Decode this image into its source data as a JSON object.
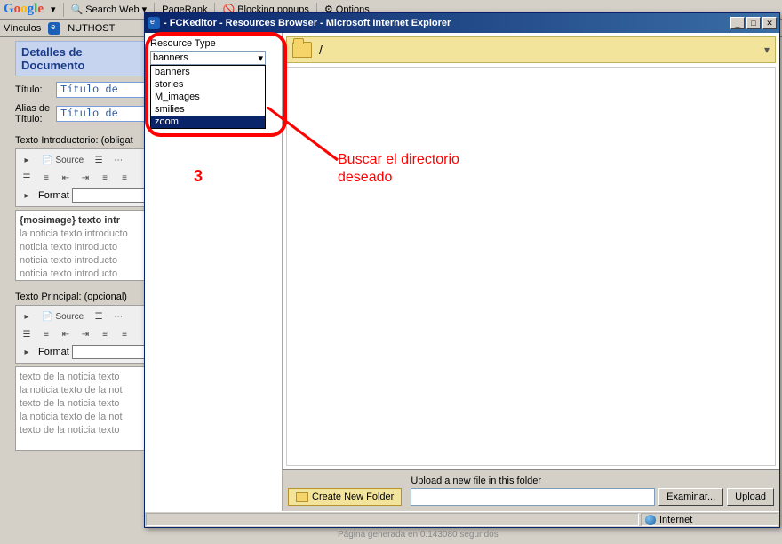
{
  "toolbar": {
    "google": "Google",
    "searchweb": "Search Web",
    "pagerank": "PageRank",
    "blocking": "Blocking popups",
    "options": "Options"
  },
  "linksbar": {
    "label": "Vínculos",
    "item": "NUTHOST"
  },
  "editor": {
    "header": "Detalles de Documento",
    "titulo_label": "Título:",
    "titulo_value": "Título de",
    "alias_label": "Alias de Título:",
    "alias_value": "Título de",
    "intro_label": "Texto Introductorio: (obligat",
    "principal_label": "Texto Principal: (opcional)",
    "source": "Source",
    "format": "Format",
    "intro_line1": "{mosimage} texto intr",
    "intro_rest": "la noticia texto introducto\nnoticia texto introducto\nnoticia texto introducto\nnoticia texto introducto",
    "main_text": "texto de la noticia texto\nla noticia texto de la not\ntexto de la noticia texto\nla noticia texto de la not\ntexto de la noticia texto"
  },
  "popup": {
    "title": "- FCKeditor - Resources Browser - Microsoft Internet Explorer",
    "restype_label": "Resource Type",
    "restype_selected": "banners",
    "restype_options": [
      "banners",
      "stories",
      "M_images",
      "smilies",
      "zoom"
    ],
    "path": "/",
    "create_folder": "Create New Folder",
    "upload_label": "Upload a new file in this folder",
    "browse_btn": "Examinar...",
    "upload_btn": "Upload",
    "status_zone": "Internet"
  },
  "annotation": {
    "num": "3",
    "text": "Buscar el directorio\ndeseado"
  },
  "footer": "Página generada en 0.143080 segundos"
}
